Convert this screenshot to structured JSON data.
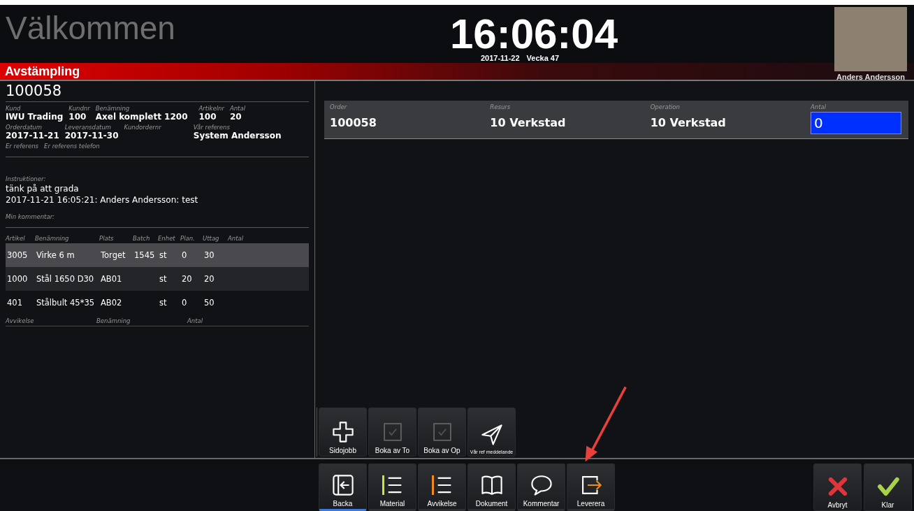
{
  "header": {
    "title": "Välkommen",
    "time": "16:06:04",
    "date": "2017-11-22",
    "week": "Vecka 47",
    "user": "Anders Andersson"
  },
  "section_title": "Avstämpling",
  "order_number": "100058",
  "order_fields": [
    [
      {
        "label": "Kund",
        "value": "IWU Trading"
      },
      {
        "label": "Kundnr",
        "value": "100"
      },
      {
        "label": "Benämning",
        "value": "Axel komplett 1200"
      },
      {
        "label": "Artikelnr",
        "value": "100"
      },
      {
        "label": "Antal",
        "value": "20"
      }
    ],
    [
      {
        "label": "Orderdatum",
        "value": "2017-11-21"
      },
      {
        "label": "Leveransdatum",
        "value": "2017-11-30"
      },
      {
        "label": "Kundordernr"
      },
      {
        "label": "Vår referens",
        "value": "System Andersson"
      }
    ],
    [
      {
        "label": "Er referens"
      },
      {
        "label": "Er referens telefon"
      }
    ]
  ],
  "instructions": {
    "label": "Instruktioner:",
    "lines": [
      "tänk på att grada",
      "2017-11-21 16:05:21: Anders Andersson: test"
    ]
  },
  "comment_label": "Min kommentar:",
  "materials": {
    "columns": [
      "Artikel",
      "Benämning",
      "Plats",
      "Batch",
      "Enhet",
      "Plan.",
      "Uttag",
      "Antal"
    ],
    "rows": [
      {
        "cells": [
          "3005",
          "Virke 6 m",
          "Torget",
          "1545",
          "st",
          "0",
          "30"
        ],
        "selected": true
      },
      {
        "cells": [
          "1000",
          "Stål 1650 D30",
          "AB01",
          "",
          "st",
          "20",
          "20"
        ],
        "selected": false
      },
      {
        "cells": [
          "401",
          "Stålbult 45*35",
          "AB02",
          "",
          "st",
          "0",
          "50"
        ],
        "selected": false
      }
    ]
  },
  "deviations": {
    "columns": [
      "Avvikelse",
      "Benämning",
      "Antal"
    ]
  },
  "operation": {
    "columns": [
      "Order",
      "Resurs",
      "Operation",
      "Antal"
    ],
    "values": [
      "100058",
      "10 Verkstad",
      "10 Verkstad"
    ],
    "quantity": "0"
  },
  "action_buttons": [
    {
      "label": "Sidojobb",
      "kind": "plus"
    },
    {
      "label": "Boka av To",
      "kind": "checkbox"
    },
    {
      "label": "Boka av Op",
      "kind": "checkbox"
    },
    {
      "label": "Vår ref meddelande",
      "kind": "send"
    }
  ],
  "nav_buttons": [
    {
      "label": "Backa",
      "kind": "back",
      "selected": true
    },
    {
      "label": "Material",
      "kind": "list",
      "color": "#c8e63c",
      "selected": false
    },
    {
      "label": "Avvikelse",
      "kind": "list",
      "color": "#f08a1c",
      "selected": false
    },
    {
      "label": "Dokument",
      "kind": "book",
      "selected": false
    },
    {
      "label": "Kommentar",
      "kind": "comment",
      "selected": false
    },
    {
      "label": "Leverera",
      "kind": "deliver",
      "selected": false
    }
  ],
  "confirm_buttons": [
    {
      "label": "Avbryt",
      "kind": "cancel"
    },
    {
      "label": "Klar",
      "kind": "ok"
    }
  ]
}
